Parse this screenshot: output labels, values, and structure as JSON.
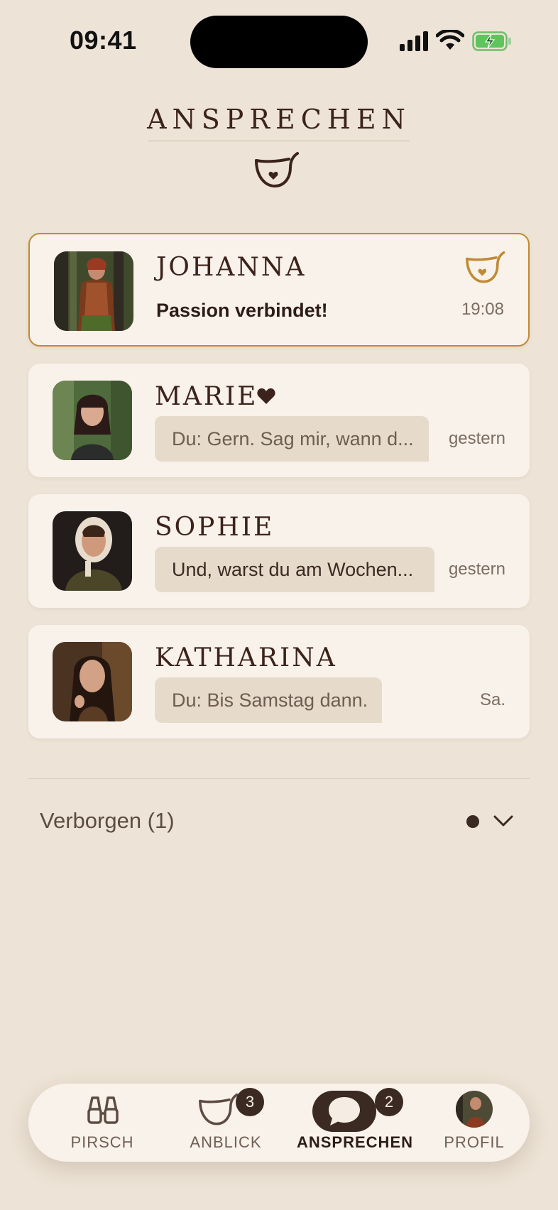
{
  "status_bar": {
    "time": "09:41",
    "icons": [
      "signal-icon",
      "wifi-icon",
      "battery-charging-icon"
    ]
  },
  "header": {
    "title": "ANSPRECHEN",
    "icon": "horn-heart-icon"
  },
  "conversations": [
    {
      "name": "JOHANNA",
      "preview": "Passion verbindet!",
      "time": "19:08",
      "badge_icon": "horn-heart-icon",
      "highlighted": true,
      "favorite": false
    },
    {
      "name": "MARIE",
      "preview": "Du: Gern. Sag mir, wann d...",
      "time": "gestern",
      "favorite": true,
      "favorite_icon": "heart-icon"
    },
    {
      "name": "SOPHIE",
      "preview": "Und, warst du am Wochen...",
      "time": "gestern",
      "favorite": false
    },
    {
      "name": "KATHARINA",
      "preview": "Du: Bis Samstag dann.",
      "time": "Sa.",
      "favorite": false
    }
  ],
  "hidden_section": {
    "label": "Verborgen (1)",
    "icon": "chevron-down-icon"
  },
  "tab_bar": {
    "tabs": [
      {
        "label": "PIRSCH",
        "icon": "binoculars-icon",
        "badge": ""
      },
      {
        "label": "ANBLICK",
        "icon": "horn-icon",
        "badge": "3"
      },
      {
        "label": "ANSPRECHEN",
        "icon": "chat-bubble-icon",
        "badge": "2",
        "active": true
      },
      {
        "label": "PROFIL",
        "icon": "profile-avatar",
        "badge": ""
      }
    ]
  },
  "colors": {
    "background": "#ede3d6",
    "card": "#f9f2ea",
    "accent_gold": "#c08a35",
    "text_dark": "#3b231c"
  }
}
